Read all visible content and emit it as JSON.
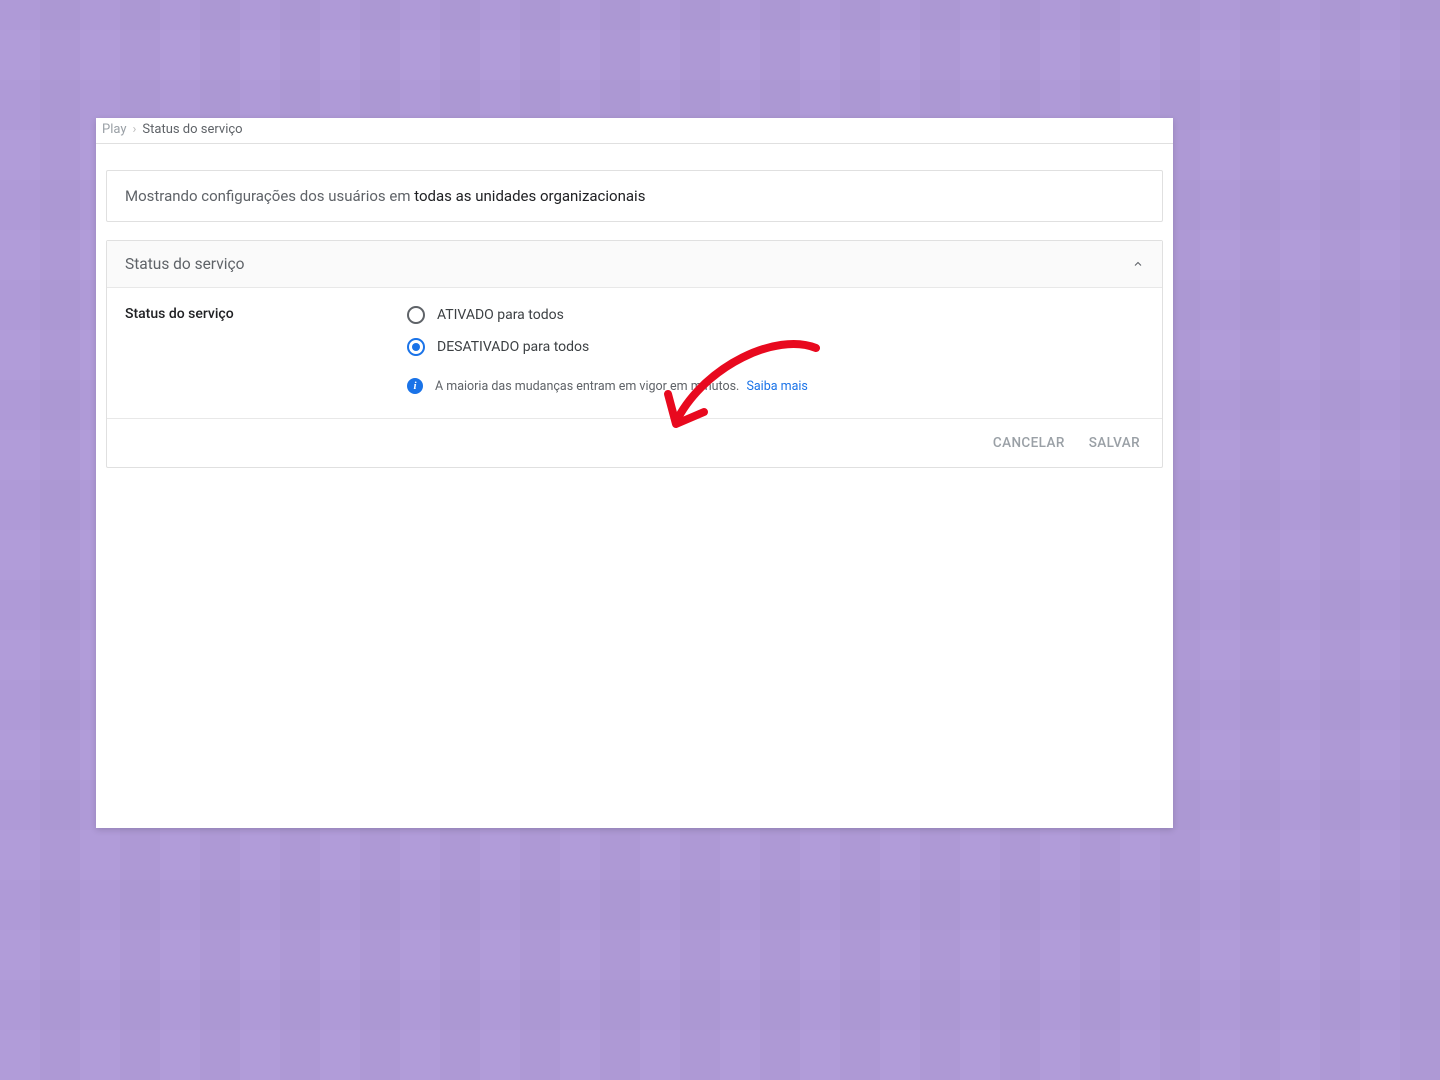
{
  "breadcrumb": {
    "prev": "Play",
    "separator": "›",
    "current": "Status do serviço"
  },
  "scope": {
    "prefix": "Mostrando configurações dos usuários em ",
    "bold": "todas as unidades organizacionais"
  },
  "card": {
    "header_title": "Status do serviço",
    "side_label": "Status do serviço",
    "options": [
      {
        "label": "ATIVADO para todos",
        "selected": false
      },
      {
        "label": "DESATIVADO para todos",
        "selected": true
      }
    ],
    "info_text": "A maioria das mudanças entram em vigor em minutos.",
    "info_link": "Saiba mais"
  },
  "footer": {
    "cancel": "CANCELAR",
    "save": "SALVAR"
  },
  "colors": {
    "accent": "#1a73e8",
    "bg": "#b19cd9",
    "annotation": "#e8091e"
  }
}
